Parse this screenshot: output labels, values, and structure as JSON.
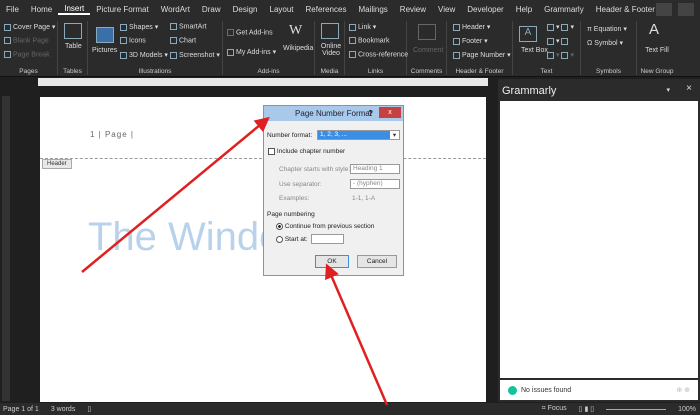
{
  "tabs": [
    "File",
    "Home",
    "Insert",
    "Picture Format",
    "WordArt",
    "Draw",
    "Design",
    "Layout",
    "References",
    "Mailings",
    "Review",
    "View",
    "Developer",
    "Help",
    "Grammarly",
    "Header & Footer"
  ],
  "ribbon": {
    "pages": {
      "label": "Pages",
      "items": [
        "Cover Page",
        "Blank Page",
        "Page Break"
      ]
    },
    "tables": {
      "label": "Tables",
      "items": [
        "Table"
      ]
    },
    "illustrations": {
      "label": "Illustrations",
      "items": [
        "Pictures",
        "Shapes",
        "Icons",
        "3D Models",
        "SmartArt",
        "Chart",
        "Screenshot"
      ]
    },
    "addins": {
      "label": "Add-ins",
      "items": [
        "Get Add-ins",
        "My Add-ins",
        "Wikipedia"
      ]
    },
    "media": {
      "label": "Media",
      "items": [
        "Online Video"
      ]
    },
    "links": {
      "label": "Links",
      "items": [
        "Link",
        "Bookmark",
        "Cross-reference"
      ]
    },
    "comments": {
      "label": "Comments",
      "items": [
        "Comment"
      ]
    },
    "headerfooter": {
      "label": "Header & Footer",
      "items": [
        "Header",
        "Footer",
        "Page Number"
      ]
    },
    "text": {
      "label": "Text",
      "items": [
        "Text Box"
      ]
    },
    "symbols": {
      "label": "Symbols",
      "items": [
        "Equation",
        "Symbol"
      ]
    },
    "newgroup": {
      "label": "New Group",
      "items": [
        "Text Fill"
      ]
    }
  },
  "document": {
    "header_text": "1 | Page |",
    "header_tag": "Header",
    "wordart": "The Windows"
  },
  "dialog": {
    "title": "Page Number Format",
    "help": "?",
    "close": "x",
    "number_format_label": "Number format:",
    "number_format_value": "1, 2, 3, ...",
    "include_chapter": "Include chapter number",
    "chapter_style_label": "Chapter starts with style:",
    "chapter_style_value": "Heading 1",
    "separator_label": "Use separator:",
    "separator_value": "-  (hyphen)",
    "examples_label": "Examples:",
    "examples_value": "1-1, 1-A",
    "page_numbering": "Page numbering",
    "continue": "Continue from previous section",
    "start_at": "Start at:",
    "ok": "OK",
    "cancel": "Cancel"
  },
  "grammarly": {
    "title": "Grammarly",
    "status": "No issues found"
  },
  "statusbar": {
    "page": "Page 1 of 1",
    "words": "3 words",
    "focus": "Focus",
    "zoom": "100%"
  },
  "colors": {
    "arrow": "#e02020",
    "accent": "#2b579a"
  }
}
